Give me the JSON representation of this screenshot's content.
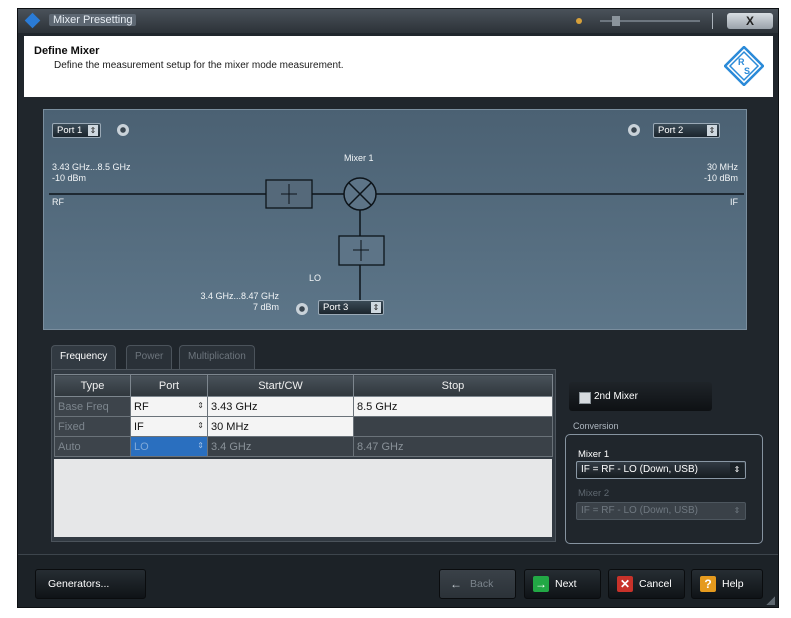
{
  "window": {
    "title": "Mixer Presetting",
    "close_label": "X"
  },
  "header": {
    "title": "Define Mixer",
    "description": "Define the measurement setup for the mixer mode measurement."
  },
  "diagram": {
    "port_rf": "Port 1",
    "port_if": "Port 2",
    "port_lo": "Port 3",
    "mixer_label": "Mixer 1",
    "rf_freq": "3.43 GHz...8.5 GHz",
    "rf_power": "-10 dBm",
    "rf_label": "RF",
    "if_freq": "30 MHz",
    "if_power": "-10 dBm",
    "if_label": "IF",
    "lo_label": "LO",
    "lo_freq": "3.4 GHz...8.47 GHz",
    "lo_power": "7 dBm"
  },
  "tabs": [
    {
      "label": "Frequency",
      "active": true
    },
    {
      "label": "Power",
      "active": false
    },
    {
      "label": "Multiplication",
      "active": false
    }
  ],
  "table": {
    "headers": [
      "Type",
      "Port",
      "Start/CW",
      "Stop"
    ],
    "rows": [
      {
        "type": "Base Freq",
        "port": "RF",
        "start": "3.43 GHz",
        "stop": "8.5 GHz"
      },
      {
        "type": "Fixed",
        "port": "IF",
        "start": "30 MHz",
        "stop": ""
      },
      {
        "type": "Auto",
        "port": "LO",
        "start": "3.4 GHz",
        "stop": "8.47 GHz"
      }
    ]
  },
  "mixer2": {
    "label": "2nd Mixer",
    "checked": false
  },
  "conversion": {
    "title": "Conversion",
    "mixer1_label": "Mixer 1",
    "mixer1_value": "IF = RF - LO (Down, USB)",
    "mixer2_label": "Mixer 2",
    "mixer2_value": "IF = RF - LO (Down, USB)"
  },
  "buttons": {
    "generators": "Generators...",
    "back": "Back",
    "next": "Next",
    "cancel": "Cancel",
    "help": "Help"
  },
  "colors": {
    "accent": "#2a6fbf",
    "diagram_bg": "#4b6173",
    "next_icon": "#22a845",
    "cancel_icon": "#c8322a",
    "help_icon": "#e59a1e"
  }
}
